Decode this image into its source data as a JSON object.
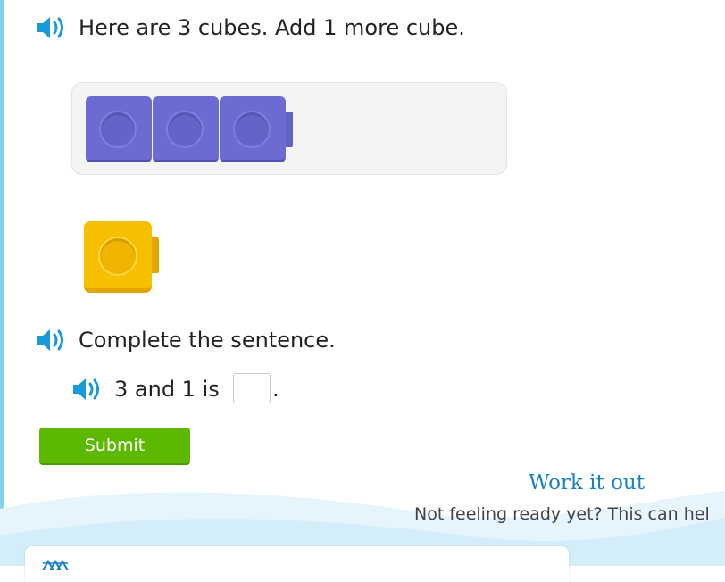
{
  "question": {
    "prompt": "Here are 3 cubes. Add 1 more cube.",
    "cube_count": 3,
    "extra_cube_count": 1
  },
  "task": {
    "prompt": "Complete the sentence.",
    "sentence_prefix": "3 and 1 is",
    "sentence_suffix": ".",
    "answer_value": ""
  },
  "submit": {
    "label": "Submit"
  },
  "work_it_out": {
    "title": "Work it out",
    "subtitle": "Not feeling ready yet? This can hel"
  },
  "colors": {
    "speaker": "#1a9ad6",
    "cube_purple": "#6b6bd1",
    "cube_yellow": "#f6c000",
    "submit_green": "#5cb800",
    "link_blue": "#1a82c4"
  },
  "icons": [
    "speaker-icon",
    "answer-pattern-icon"
  ]
}
